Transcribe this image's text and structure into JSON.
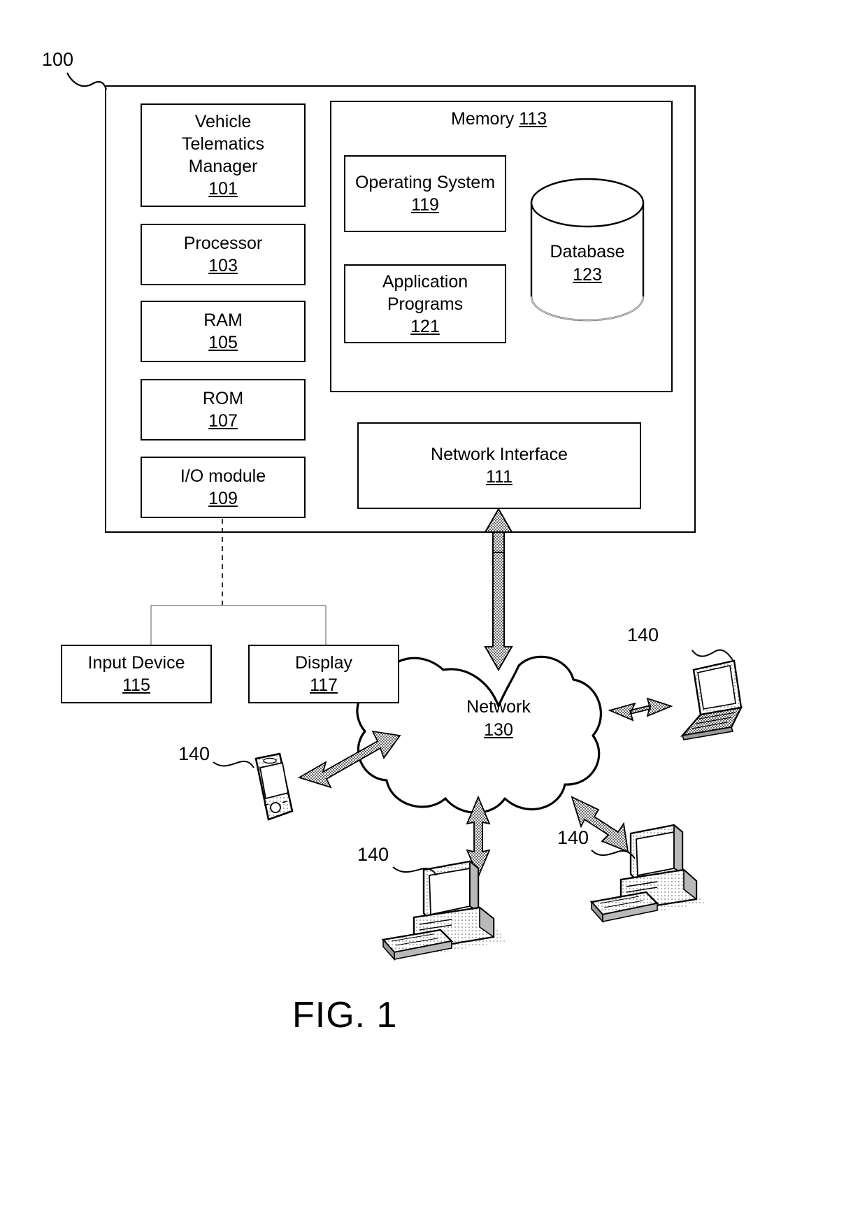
{
  "figure": {
    "caption": "FIG. 1",
    "system_ref": "100"
  },
  "computing_device": {
    "components": [
      {
        "label_line1": "Vehicle",
        "label_line2": "Telematics",
        "label_line3": "Manager",
        "ref": "101"
      },
      {
        "label_line1": "Processor",
        "ref": "103"
      },
      {
        "label_line1": "RAM",
        "ref": "105"
      },
      {
        "label_line1": "ROM",
        "ref": "107"
      },
      {
        "label_line1": "I/O module",
        "ref": "109"
      }
    ],
    "network_interface": {
      "label": "Network Interface",
      "ref": "111"
    }
  },
  "memory": {
    "title": "Memory",
    "ref": "113",
    "blocks": [
      {
        "label_line1": "Operating System",
        "ref": "119"
      },
      {
        "label_line1": "Application",
        "label_line2": "Programs",
        "ref": "121"
      }
    ],
    "database": {
      "label": "Database",
      "ref": "123"
    }
  },
  "peripherals": [
    {
      "label": "Input Device",
      "ref": "115"
    },
    {
      "label": "Display",
      "ref": "117"
    }
  ],
  "network": {
    "label": "Network",
    "ref": "130"
  },
  "remote_devices": [
    {
      "kind": "laptop",
      "ref": "140"
    },
    {
      "kind": "mobile-phone",
      "ref": "140"
    },
    {
      "kind": "desktop-computer",
      "ref": "140"
    },
    {
      "kind": "desktop-computer",
      "ref": "140"
    }
  ],
  "colors": {
    "line": "#000000",
    "background": "#ffffff",
    "shade_light": "#d8d8d8",
    "shade_mid": "#b5b5b5",
    "shade_dark": "#8a8a8a"
  }
}
